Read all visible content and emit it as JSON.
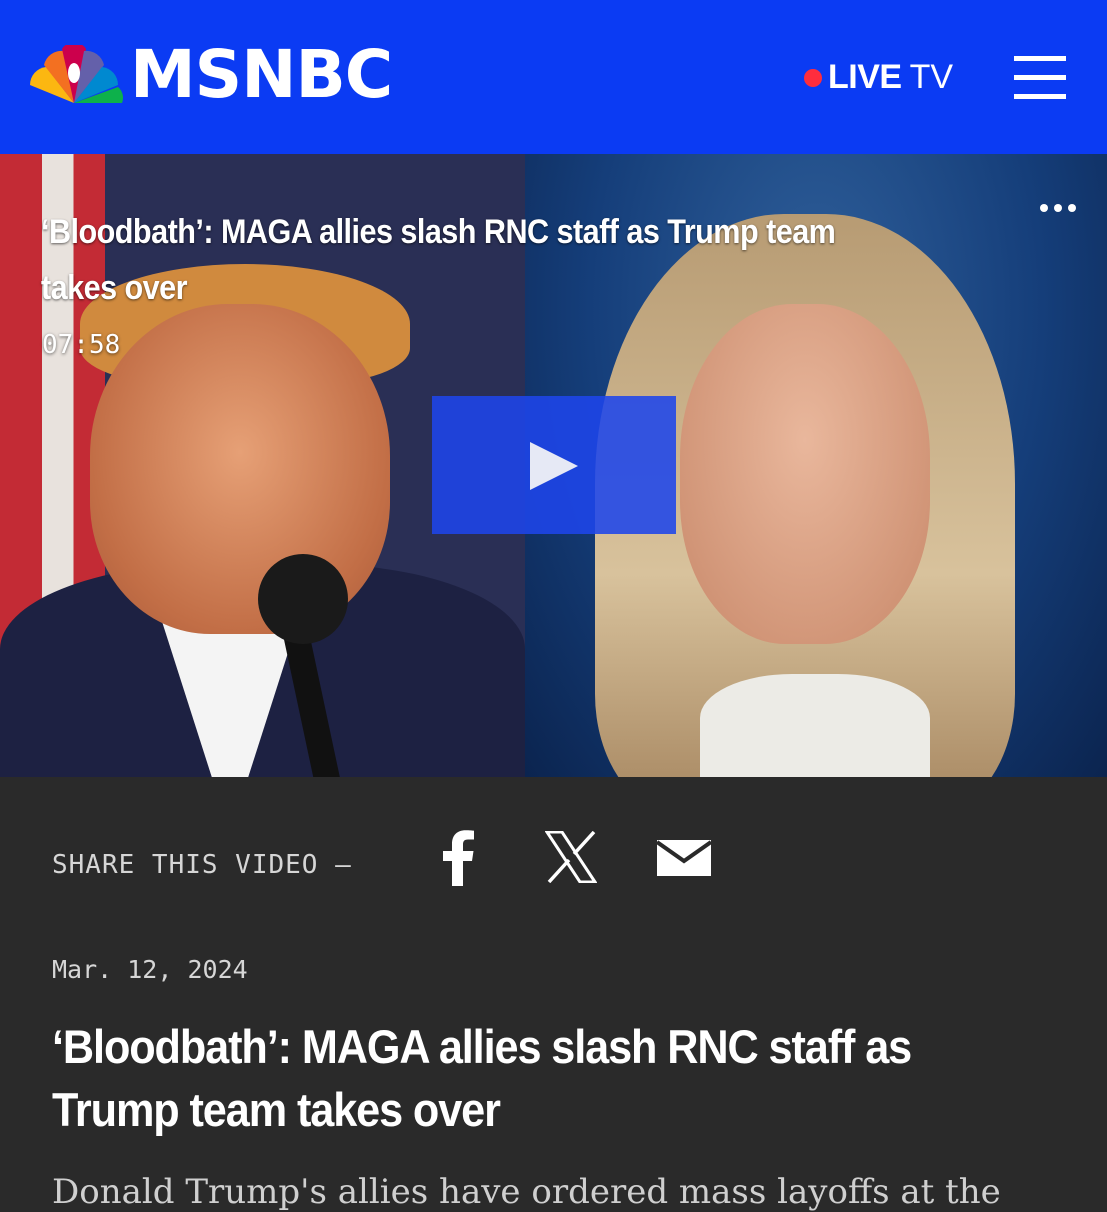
{
  "header": {
    "brand": "MSNBC",
    "live_bold": "LIVE",
    "live_thin": "TV",
    "colors": {
      "background": "#0b3bf3",
      "live_dot": "#ff2d3d"
    }
  },
  "video": {
    "title": "‘Bloodbath’: MAGA allies slash RNC staff as Trump team takes over",
    "duration": "07:58"
  },
  "share": {
    "label": "SHARE THIS VIDEO —",
    "icons": [
      "facebook-icon",
      "x-icon",
      "email-icon"
    ]
  },
  "article": {
    "date": "Mar. 12, 2024",
    "headline": "‘Bloodbath’: MAGA allies slash RNC staff as Trump team takes over",
    "dek": "Donald Trump's allies have ordered mass layoffs at the"
  }
}
